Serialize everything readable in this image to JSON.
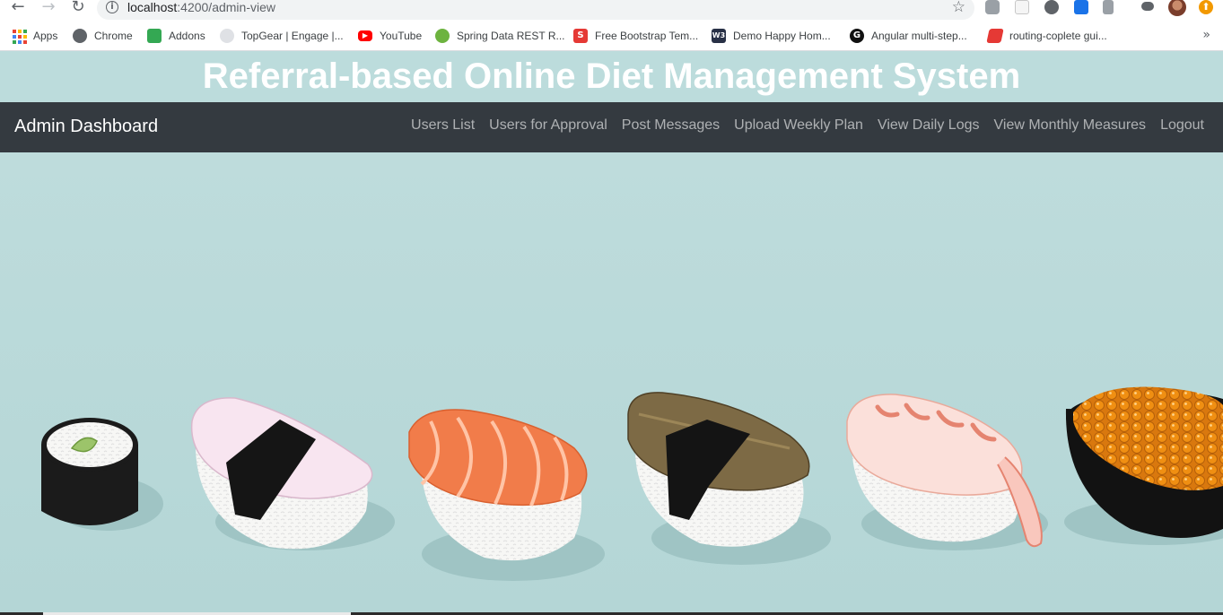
{
  "browser": {
    "back": "←",
    "forward": "→",
    "reload": "↻",
    "info": "i",
    "url_host": "localhost",
    "url_path": ":4200/admin-view",
    "star": "☆",
    "more": "»"
  },
  "bookmarks": [
    {
      "label": "Apps",
      "icon": "apps-grid-icon"
    },
    {
      "label": "Chrome",
      "icon": "globe-icon",
      "color": "#5f6368"
    },
    {
      "label": "Addons",
      "icon": "puzzle-icon",
      "color": "#34a853"
    },
    {
      "label": "TopGear | Engage |...",
      "icon": "topgear-icon",
      "color": "#9aa0a6"
    },
    {
      "label": "YouTube",
      "icon": "youtube-icon",
      "color": "#ff0000"
    },
    {
      "label": "Spring Data REST R...",
      "icon": "spring-icon",
      "color": "#6db33f"
    },
    {
      "label": "Free Bootstrap Tem...",
      "icon": "s-icon",
      "color": "#e53935"
    },
    {
      "label": "Demo Happy Hom...",
      "icon": "w3-icon",
      "color": "#283046"
    },
    {
      "label": "Angular multi-step...",
      "icon": "g-icon",
      "color": "#111111"
    },
    {
      "label": "routing-coplete gui...",
      "icon": "routing-icon",
      "color": "#e53935"
    }
  ],
  "page": {
    "title": "Referral-based Online Diet Management System"
  },
  "navbar": {
    "brand": "Admin Dashboard",
    "links": [
      "Users List",
      "Users for Approval",
      "Post Messages",
      "Upload Weekly Plan",
      "View Daily Logs",
      "View Monthly Measures",
      "Logout"
    ]
  },
  "colors": {
    "header_bg": "#bcdcdc",
    "navbar_bg": "#343a40",
    "title_text": "#ffffff"
  }
}
